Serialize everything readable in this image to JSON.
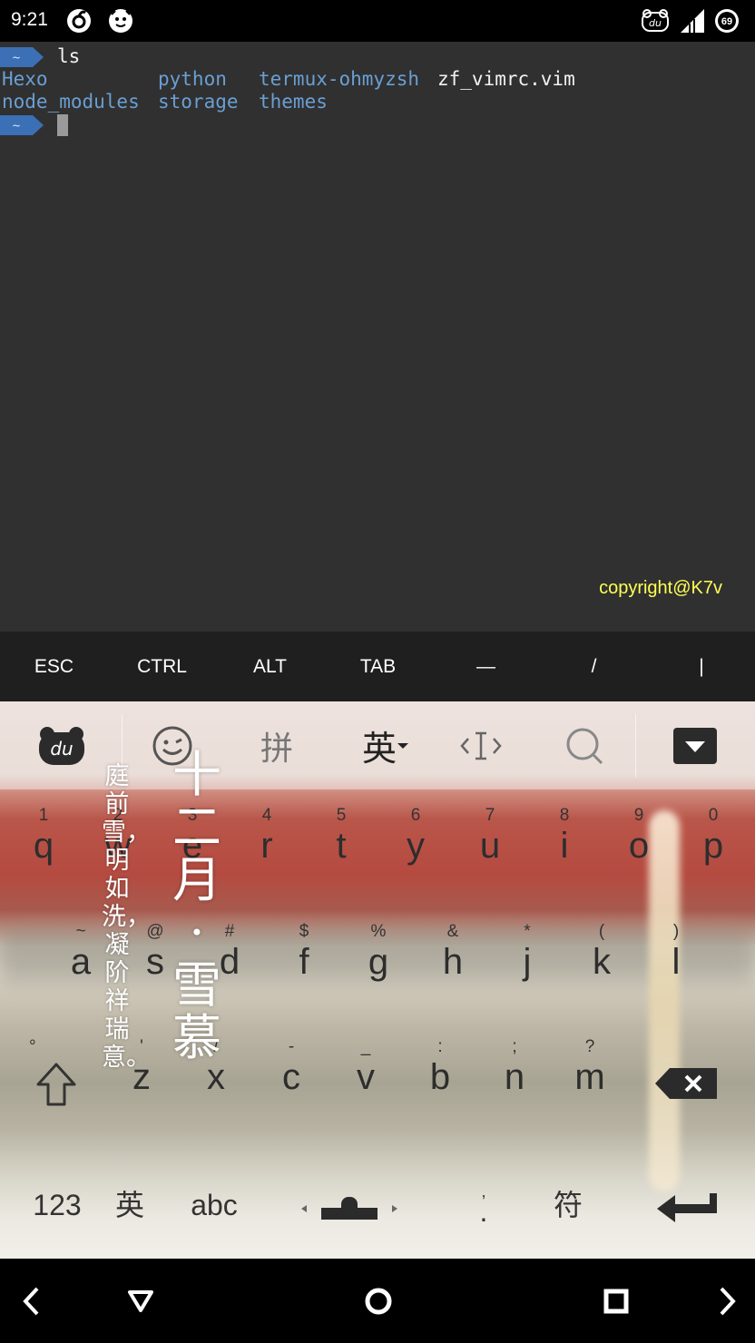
{
  "status_bar": {
    "time": "9:21",
    "icons_left": [
      "netease-music-icon",
      "lion-app-icon"
    ],
    "icons_right": [
      "baidu-ime-icon",
      "cell-signal-icon",
      "battery-icon"
    ],
    "battery_level": "69"
  },
  "terminal": {
    "prompt_symbol": "~",
    "command": "ls",
    "listing_row1": [
      "Hexo",
      "python",
      "termux-ohmyzsh",
      "zf_vimrc.vim"
    ],
    "listing_row2": [
      "node_modules",
      "storage",
      "themes"
    ],
    "watermark": "copyright@K7v",
    "colors": {
      "background": "#303030",
      "directory": "#6a9fd3",
      "file": "#f2f2f2",
      "prompt": "#3b6fb6"
    }
  },
  "extra_keys": [
    "ESC",
    "CTRL",
    "ALT",
    "TAB",
    "—",
    "/",
    "|"
  ],
  "ime_toolbar": {
    "logo": "du",
    "pinyin_label": "拼",
    "english_label": "英",
    "icons": [
      "emoji-icon",
      "cursor-move-icon",
      "search-icon",
      "collapse-keyboard-icon"
    ]
  },
  "keyboard": {
    "row1": [
      {
        "hint": "1",
        "key": "q"
      },
      {
        "hint": "2",
        "key": "w"
      },
      {
        "hint": "3",
        "key": "e"
      },
      {
        "hint": "4",
        "key": "r"
      },
      {
        "hint": "5",
        "key": "t"
      },
      {
        "hint": "6",
        "key": "y"
      },
      {
        "hint": "7",
        "key": "u"
      },
      {
        "hint": "8",
        "key": "i"
      },
      {
        "hint": "9",
        "key": "o"
      },
      {
        "hint": "0",
        "key": "p"
      }
    ],
    "row2": [
      {
        "hint": "~",
        "key": "a"
      },
      {
        "hint": "@",
        "key": "s"
      },
      {
        "hint": "#",
        "key": "d"
      },
      {
        "hint": "$",
        "key": "f"
      },
      {
        "hint": "%",
        "key": "g"
      },
      {
        "hint": "&",
        "key": "h"
      },
      {
        "hint": "*",
        "key": "j"
      },
      {
        "hint": "(",
        "key": "k"
      },
      {
        "hint": ")",
        "key": "l"
      }
    ],
    "row3": [
      {
        "hint": "'",
        "key": "z"
      },
      {
        "hint": "/",
        "key": "x"
      },
      {
        "hint": "-",
        "key": "c"
      },
      {
        "hint": "_",
        "key": "v"
      },
      {
        "hint": ":",
        "key": "b"
      },
      {
        "hint": ";",
        "key": "n"
      },
      {
        "hint": "?",
        "key": "m"
      }
    ],
    "shift_hint": "°",
    "bottom": {
      "numbers": "123",
      "lang": "英",
      "abc": "abc",
      "punct_hint": ",",
      "punct": ".",
      "symbols": "符"
    },
    "poem_small": "庭前雪，明如洗，凝阶祥瑞意。",
    "poem_big": "十二月·雪慕"
  },
  "nav_bar": {
    "buttons": [
      "back-icon",
      "triangle-back-icon",
      "home-icon",
      "recents-icon",
      "forward-icon"
    ]
  }
}
